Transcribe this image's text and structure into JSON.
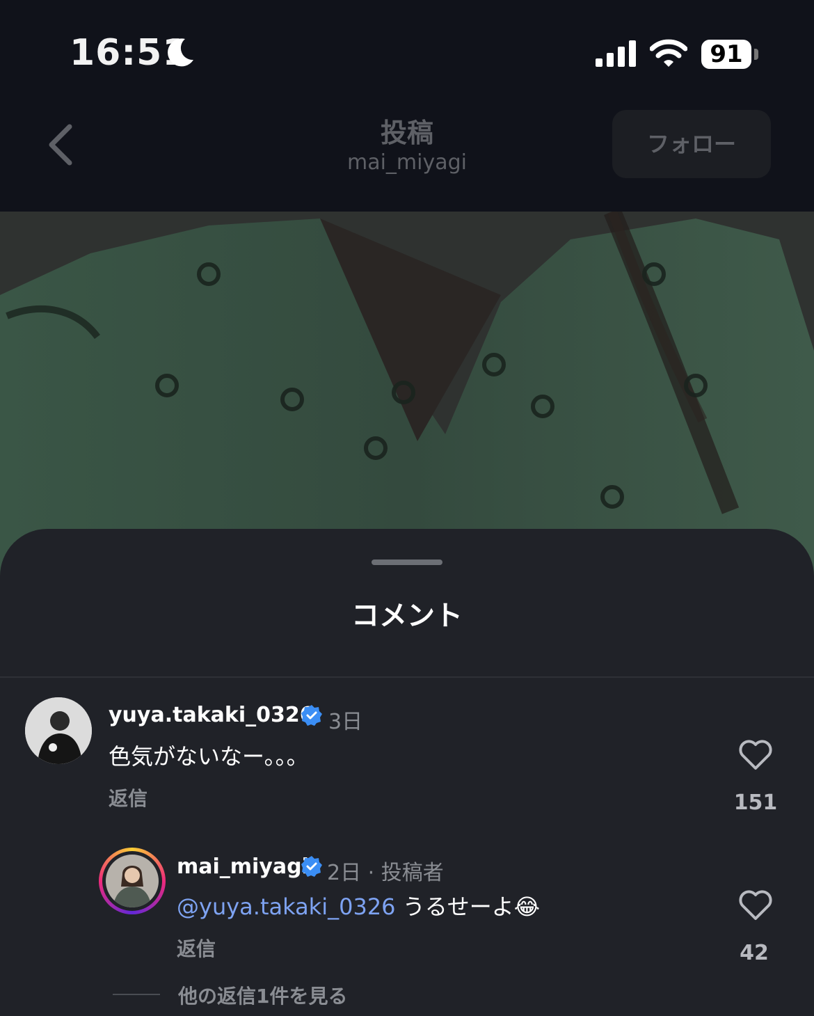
{
  "status": {
    "time": "16:51",
    "battery": "91"
  },
  "header": {
    "title": "投稿",
    "username": "mai_miyagi",
    "follow_label": "フォロー"
  },
  "sheet": {
    "title": "コメント"
  },
  "comments": [
    {
      "username": "yuya.takaki_0326",
      "time": "3日",
      "text": "色気がないなー。。。",
      "reply_label": "返信",
      "likes": "151"
    }
  ],
  "reply": {
    "username": "mai_miyagi",
    "meta": "2日 · 投稿者",
    "mention": "@yuya.takaki_0326",
    "text": " うるせーよ😂",
    "reply_label": "返信",
    "likes": "42",
    "more_replies": "他の返信1件を見る"
  },
  "colors": {
    "verified": "#3b8ef5",
    "mention": "#7ea3f2",
    "sheet_bg": "#202228"
  }
}
